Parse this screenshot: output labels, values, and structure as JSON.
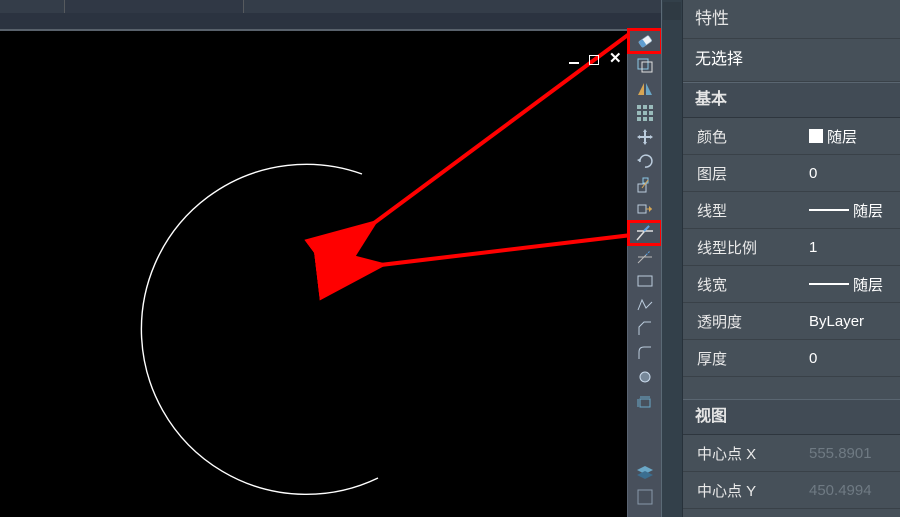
{
  "viewport": {
    "min_icon": "minimize-icon",
    "max_icon": "maximize-icon",
    "close_icon": "close-icon"
  },
  "tools": [
    {
      "name": "eraser-icon",
      "highlight": true
    },
    {
      "name": "copy-properties-icon"
    },
    {
      "name": "mirror-icon"
    },
    {
      "name": "array-icon"
    },
    {
      "name": "move-icon"
    },
    {
      "name": "rotate-icon"
    },
    {
      "name": "scale-icon"
    },
    {
      "name": "stretch-icon"
    },
    {
      "name": "trim-icon",
      "highlight": true
    },
    {
      "name": "extend-icon"
    },
    {
      "name": "rectangle-icon"
    },
    {
      "name": "polyline-icon"
    },
    {
      "name": "chamfer-icon"
    },
    {
      "name": "fillet-icon"
    },
    {
      "name": "point-icon"
    },
    {
      "name": "explode-icon"
    }
  ],
  "properties": {
    "title": "特性",
    "selection": "无选择",
    "sections": {
      "basic": {
        "header": "基本",
        "rows": {
          "color": {
            "label": "颜色",
            "value": "随层",
            "with_swatch": true
          },
          "layer": {
            "label": "图层",
            "value": "0"
          },
          "linetype": {
            "label": "线型",
            "value": "随层",
            "with_line": true
          },
          "ltscale": {
            "label": "线型比例",
            "value": "1"
          },
          "lineweight": {
            "label": "线宽",
            "value": "随层",
            "with_line": true
          },
          "transparency": {
            "label": "透明度",
            "value": "ByLayer"
          },
          "thickness": {
            "label": "厚度",
            "value": "0"
          }
        }
      },
      "view": {
        "header": "视图",
        "rows": {
          "center_x": {
            "label": "中心点 X",
            "value": "555.8901"
          },
          "center_y": {
            "label": "中心点 Y",
            "value": "450.4994"
          }
        }
      }
    }
  }
}
